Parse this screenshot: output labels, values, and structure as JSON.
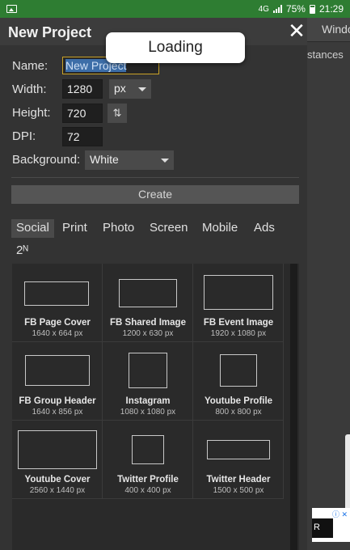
{
  "status_bar": {
    "battery": "75%",
    "time": "21:29",
    "network": "4G"
  },
  "background_app": {
    "menu_label": "Windo",
    "panel_label": "stances"
  },
  "dialog": {
    "title": "New Project",
    "close_icon": "close-x",
    "loading_text": "Loading",
    "fields": {
      "name_label": "Name:",
      "name_value": "New Project",
      "width_label": "Width:",
      "width_value": "1280",
      "unit": "px",
      "height_label": "Height:",
      "height_value": "720",
      "swap_icon": "⇅",
      "dpi_label": "DPI:",
      "dpi_value": "72",
      "background_label": "Background:",
      "background_value": "White"
    },
    "create_label": "Create",
    "tabs": [
      "Social",
      "Print",
      "Photo",
      "Screen",
      "Mobile",
      "Ads",
      "2ᴺ"
    ],
    "active_tab": "Social",
    "presets": [
      {
        "name": "FB Page Cover",
        "size": "1640 x 664 px"
      },
      {
        "name": "FB Shared Image",
        "size": "1200 x 630 px"
      },
      {
        "name": "FB Event Image",
        "size": "1920 x 1080 px"
      },
      {
        "name": "FB Group Header",
        "size": "1640 x 856 px"
      },
      {
        "name": "Instagram",
        "size": "1080 x 1080 px"
      },
      {
        "name": "Youtube Profile",
        "size": "800 x 800 px"
      },
      {
        "name": "Youtube Cover",
        "size": "2560 x 1440 px"
      },
      {
        "name": "Twitter Profile",
        "size": "400 x 400 px"
      },
      {
        "name": "Twitter Header",
        "size": "1500 x 500 px"
      }
    ]
  },
  "ad": {
    "letter": "R",
    "close": "ⓘ ✕"
  },
  "colors": {
    "status_green": "#2e7d32",
    "dialog_bg": "#333333",
    "name_highlight": "#3d6ea8",
    "name_border": "#c9a227"
  }
}
